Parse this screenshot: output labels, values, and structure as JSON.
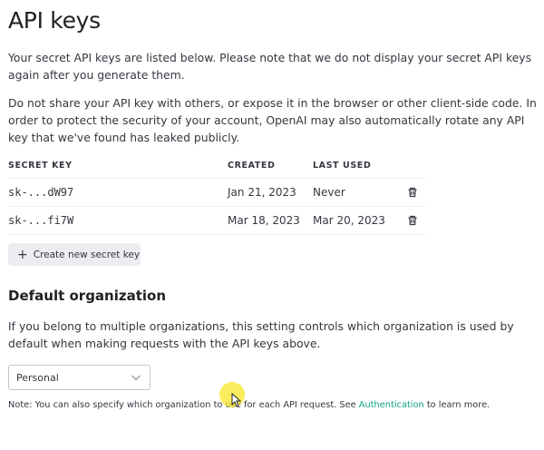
{
  "page": {
    "title": "API keys",
    "intro_1": "Your secret API keys are listed below. Please note that we do not display your secret API keys again after you generate them.",
    "intro_2": "Do not share your API key with others, or expose it in the browser or other client-side code. In order to protect the security of your account, OpenAI may also automatically rotate any API key that we've found has leaked publicly."
  },
  "keys_table": {
    "headers": [
      "SECRET KEY",
      "CREATED",
      "LAST USED"
    ],
    "rows": [
      {
        "key": "sk-...dW97",
        "created": "Jan 21, 2023",
        "last_used": "Never",
        "action_icon": "trash-icon"
      },
      {
        "key": "sk-...fi7W",
        "created": "Mar 18, 2023",
        "last_used": "Mar 20, 2023",
        "action_icon": "trash-icon"
      }
    ]
  },
  "create_button": {
    "icon": "plus-icon",
    "label": "Create new secret key"
  },
  "default_org": {
    "title": "Default organization",
    "description": "If you belong to multiple organizations, this setting controls which organization is used by default when making requests with the API keys above.",
    "select_value": "Personal",
    "note_before": "Note: You can also specify which organization to use for each API request. See ",
    "note_link": "Authentication",
    "note_after": " to learn more."
  },
  "colors": {
    "link": "#10a37f",
    "button_bg": "#ececf1",
    "cursor_highlight": "#fae628"
  }
}
